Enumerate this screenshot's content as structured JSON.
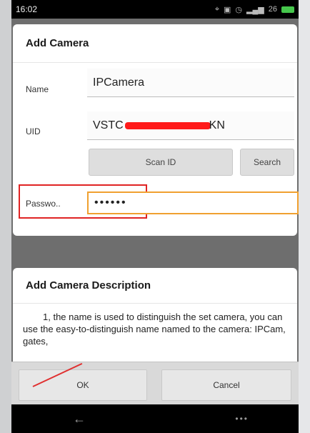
{
  "status_bar": {
    "time": "16:02",
    "icons": [
      "location-icon",
      "nfc-icon",
      "alarm-icon",
      "signal-icon",
      "battery-icon"
    ],
    "signal_text": "26",
    "battery_color": "#46c74c"
  },
  "dialog": {
    "title": "Add Camera",
    "name_label": "Name",
    "name_value": "IPCamera",
    "uid_label": "UID",
    "uid_prefix": "VSTC",
    "uid_suffix": "KN",
    "scan_button": "Scan ID",
    "search_button": "Search",
    "password_label": "Passwo..",
    "password_value": "••••••"
  },
  "description": {
    "title": "Add Camera Description",
    "text": "1, the name is used to distinguish the set camera, you can use the easy-to-distinguish name named to the camera: IPCam, gates,"
  },
  "actions": {
    "ok_label": "OK",
    "cancel_label": "Cancel"
  },
  "nav": {
    "back_icon": "back-arrow-icon",
    "menu_icon": "more-dots-icon"
  },
  "colors": {
    "highlight_red": "#e02424",
    "focus_orange": "#f0a030"
  }
}
